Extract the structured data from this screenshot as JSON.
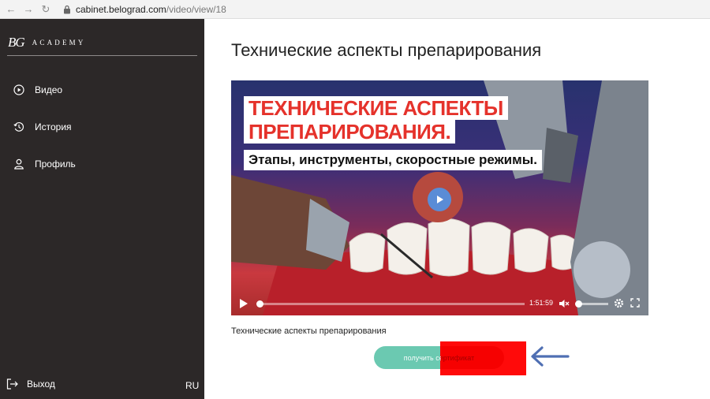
{
  "browser": {
    "url_host": "cabinet.belograd.com",
    "url_path": "/video/view/18"
  },
  "sidebar": {
    "logo": "BG",
    "brand_name": "ACADEMY",
    "items": [
      {
        "label": "Видео",
        "icon": "play-circle-icon"
      },
      {
        "label": "История",
        "icon": "history-icon"
      },
      {
        "label": "Профиль",
        "icon": "user-icon"
      }
    ],
    "logout_label": "Выход",
    "language": "RU"
  },
  "main": {
    "title": "Технические аспекты препарирования",
    "video": {
      "headline_1": "ТЕХНИЧЕСКИЕ АСПЕКТЫ",
      "headline_2": "ПРЕПАРИРОВАНИЯ.",
      "subline": "Этапы, инструменты, скоростные режимы.",
      "duration": "1:51:59",
      "progress": 0,
      "volume_level": 0
    },
    "caption": "Технические аспекты препарирования",
    "certificate_button": "получить сертификат"
  },
  "colors": {
    "sidebar_bg": "#2c2828",
    "button_accent": "#6bc9b1",
    "headline_red": "#e5322b",
    "highlight_red": "#ff0000",
    "arrow_blue": "#4f6fb3"
  }
}
